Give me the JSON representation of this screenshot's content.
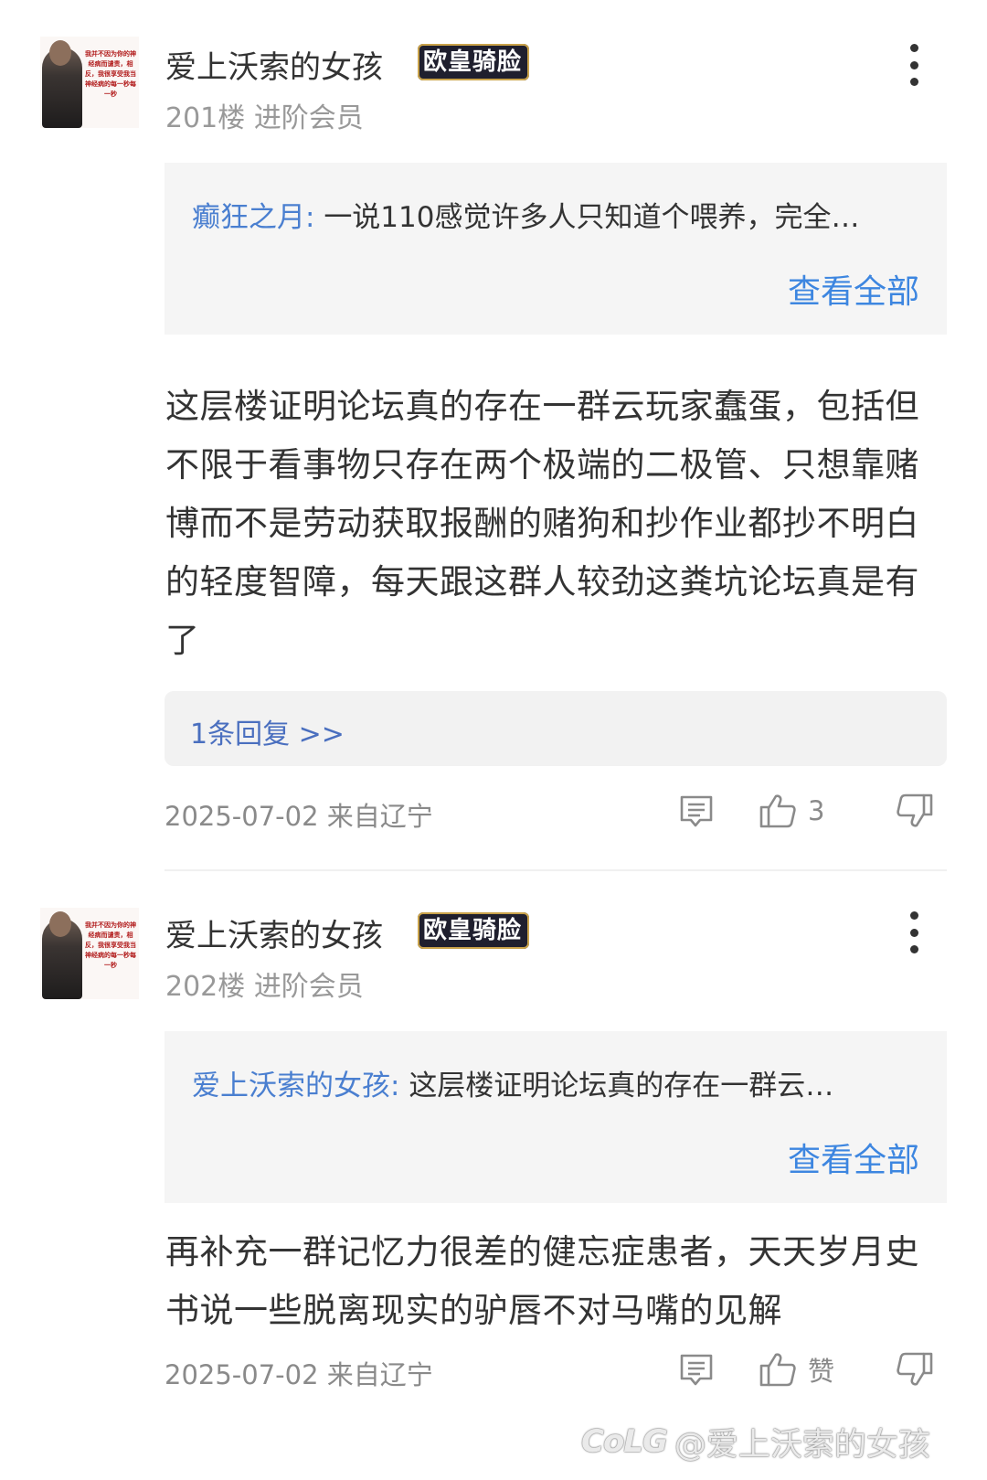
{
  "posts": [
    {
      "avatar_text": "我并不因为你的神经病而谴责，相反，我很享受我当神经病的每一秒每一秒",
      "username": "爱上沃索的女孩",
      "badge": "欧皇骑脸",
      "floor": "201楼",
      "rank": "进阶会员",
      "quote_author": "癫狂之月:",
      "quote_text": "一说110感觉许多人只知道个喂养，完全…",
      "view_all": "查看全部",
      "content": "这层楼证明论坛真的存在一群云玩家蠢蛋，包括但不限于看事物只存在两个极端的二极管、只想靠赌博而不是劳动获取报酬的赌狗和抄作业都抄不明白的轻度智障，每天跟这群人较劲这粪坑论坛真是有了",
      "replies_link": "1条回复 >>",
      "date": "2025-07-02",
      "location": "来自辽宁",
      "like_label": "3"
    },
    {
      "avatar_text": "我并不因为你的神经病而谴责，相反，我很享受我当神经病的每一秒每一秒",
      "username": "爱上沃索的女孩",
      "badge": "欧皇骑脸",
      "floor": "202楼",
      "rank": "进阶会员",
      "quote_author": "爱上沃索的女孩:",
      "quote_text": "这层楼证明论坛真的存在一群云…",
      "view_all": "查看全部",
      "content": "再补充一群记忆力很差的健忘症患者，天天岁月史书说一些脱离现实的驴唇不对马嘴的见解",
      "date": "2025-07-02",
      "location": "来自辽宁",
      "like_label": "赞"
    }
  ],
  "watermark": {
    "logo": "CoLG",
    "handle": "@爱上沃索的女孩"
  },
  "colors": {
    "link_blue": "#3d86e0",
    "quote_author_blue": "#4a7fd0",
    "text_dark": "#333333",
    "text_gray": "#999999",
    "box_bg": "#f5f5f5"
  },
  "icons": [
    "more-vertical-icon",
    "comment-icon",
    "thumbs-up-icon",
    "thumbs-down-icon"
  ]
}
